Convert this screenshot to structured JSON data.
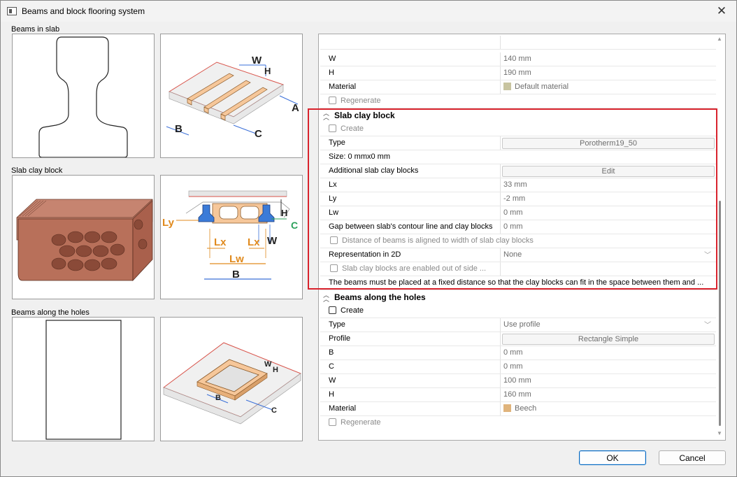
{
  "window": {
    "title": "Beams and block flooring system"
  },
  "left": {
    "groups": [
      {
        "label": "Beams in slab"
      },
      {
        "label": "Slab clay block"
      },
      {
        "label": "Beams along the holes"
      }
    ],
    "diagram1": {
      "W": "W",
      "H": "H",
      "A": "A",
      "B": "B",
      "C": "C"
    },
    "diagram2": {
      "Ly": "Ly",
      "H": "H",
      "C": "C",
      "Lx1": "Lx",
      "Lx2": "Lx",
      "W": "W",
      "Lw": "Lw",
      "B": "B"
    },
    "diagram3": {
      "W": "W",
      "H": "H",
      "B": "B",
      "C": "C"
    }
  },
  "props": {
    "beams": {
      "W": {
        "label": "W",
        "value": "140 mm"
      },
      "H": {
        "label": "H",
        "value": "190 mm"
      },
      "material": {
        "label": "Material",
        "value": "Default material",
        "swatch": "#c8c4a0"
      },
      "regenerate": {
        "label": "Regenerate"
      }
    },
    "clay": {
      "header": "Slab clay block",
      "create": "Create",
      "type": {
        "label": "Type",
        "value": "Porotherm19_50"
      },
      "size": "Size: 0 mmx0 mm",
      "additional": {
        "label": "Additional slab clay blocks",
        "value": "Edit"
      },
      "Lx": {
        "label": "Lx",
        "value": "33 mm"
      },
      "Ly": {
        "label": "Ly",
        "value": "-2 mm"
      },
      "Lw": {
        "label": "Lw",
        "value": "0 mm"
      },
      "gap": {
        "label": "Gap between slab's contour line and clay blocks",
        "value": "0 mm"
      },
      "aligned": "Distance of beams is aligned to width of slab clay blocks",
      "repr": {
        "label": "Representation in 2D",
        "value": "None"
      },
      "outside": "Slab clay blocks are enabled out of side ...",
      "note": "The beams must be placed at a fixed distance so that the clay blocks can fit in the space between them and ..."
    },
    "holes": {
      "header": "Beams along the holes",
      "create": "Create",
      "type": {
        "label": "Type",
        "value": "Use profile"
      },
      "profile": {
        "label": "Profile",
        "value": "Rectangle Simple"
      },
      "B": {
        "label": "B",
        "value": "0 mm"
      },
      "C": {
        "label": "C",
        "value": "0 mm"
      },
      "W": {
        "label": "W",
        "value": "100 mm"
      },
      "H": {
        "label": "H",
        "value": "160 mm"
      },
      "material": {
        "label": "Material",
        "value": "Beech",
        "swatch": "#e0b47c"
      },
      "regenerate": "Regenerate"
    }
  },
  "buttons": {
    "ok": "OK",
    "cancel": "Cancel"
  },
  "colors": {
    "highlight": "#d9232d",
    "accent": "#0067c0"
  }
}
